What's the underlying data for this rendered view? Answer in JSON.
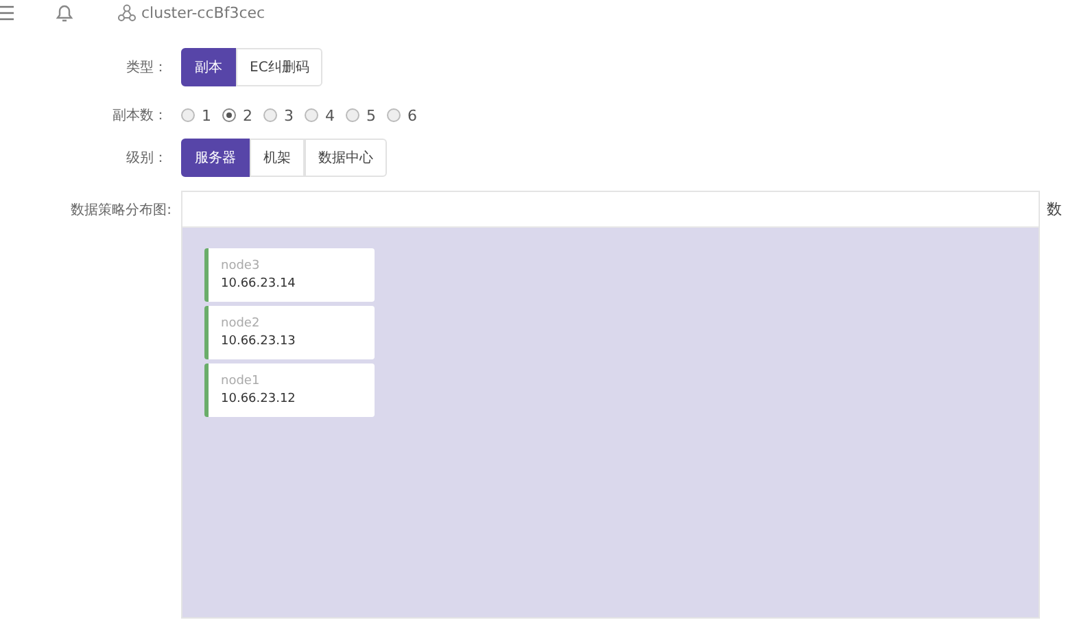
{
  "topbar": {
    "cluster": "cluster-ccBf3cec"
  },
  "type_field": {
    "label": "类型：",
    "options": [
      {
        "label": "副本",
        "selected": true
      },
      {
        "label": "EC纠删码",
        "selected": false
      }
    ]
  },
  "replica_field": {
    "label": "副本数：",
    "options": [
      {
        "label": "1",
        "selected": false
      },
      {
        "label": "2",
        "selected": true
      },
      {
        "label": "3",
        "selected": false
      },
      {
        "label": "4",
        "selected": false
      },
      {
        "label": "5",
        "selected": false
      },
      {
        "label": "6",
        "selected": false
      }
    ]
  },
  "level_field": {
    "label": "级别：",
    "options": [
      {
        "label": "服务器",
        "selected": true
      },
      {
        "label": "机架",
        "selected": false
      },
      {
        "label": "数据中心",
        "selected": false
      }
    ]
  },
  "distribution": {
    "label": "数据策略分布图:",
    "side_text": "数",
    "nodes": [
      {
        "name": "node3",
        "ip": "10.66.23.14"
      },
      {
        "name": "node2",
        "ip": "10.66.23.13"
      },
      {
        "name": "node1",
        "ip": "10.66.23.12"
      }
    ]
  }
}
